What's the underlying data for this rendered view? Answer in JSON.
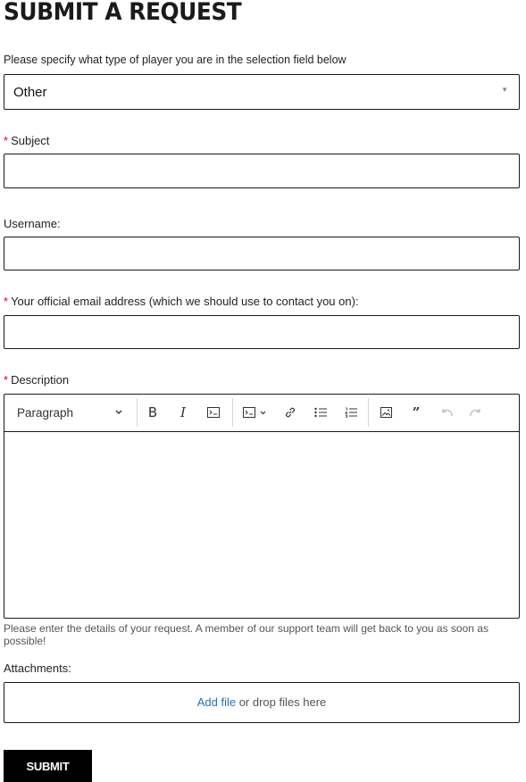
{
  "page": {
    "title": "SUBMIT A REQUEST"
  },
  "player_type": {
    "label": "Please specify what type of player you are in the selection field below",
    "selected": "Other"
  },
  "subject": {
    "required_mark": "*",
    "label": "Subject",
    "value": ""
  },
  "username": {
    "label": "Username:",
    "value": ""
  },
  "email": {
    "required_mark": "*",
    "label": "Your official email address (which we should use to contact you on):",
    "value": ""
  },
  "description": {
    "required_mark": "*",
    "label": "Description",
    "toolbar": {
      "block_format": "Paragraph",
      "icons": [
        "bold-icon",
        "italic-icon",
        "code-icon",
        "code-block-icon",
        "link-icon",
        "bulleted-list-icon",
        "numbered-list-icon",
        "image-icon",
        "quote-icon",
        "undo-icon",
        "redo-icon"
      ]
    },
    "hint": "Please enter the details of your request. A member of our support team will get back to you as soon as possible!"
  },
  "attachments": {
    "label": "Attachments:",
    "add_file": "Add file",
    "drop_text": " or drop files here"
  },
  "submit_label": "SUBMIT"
}
